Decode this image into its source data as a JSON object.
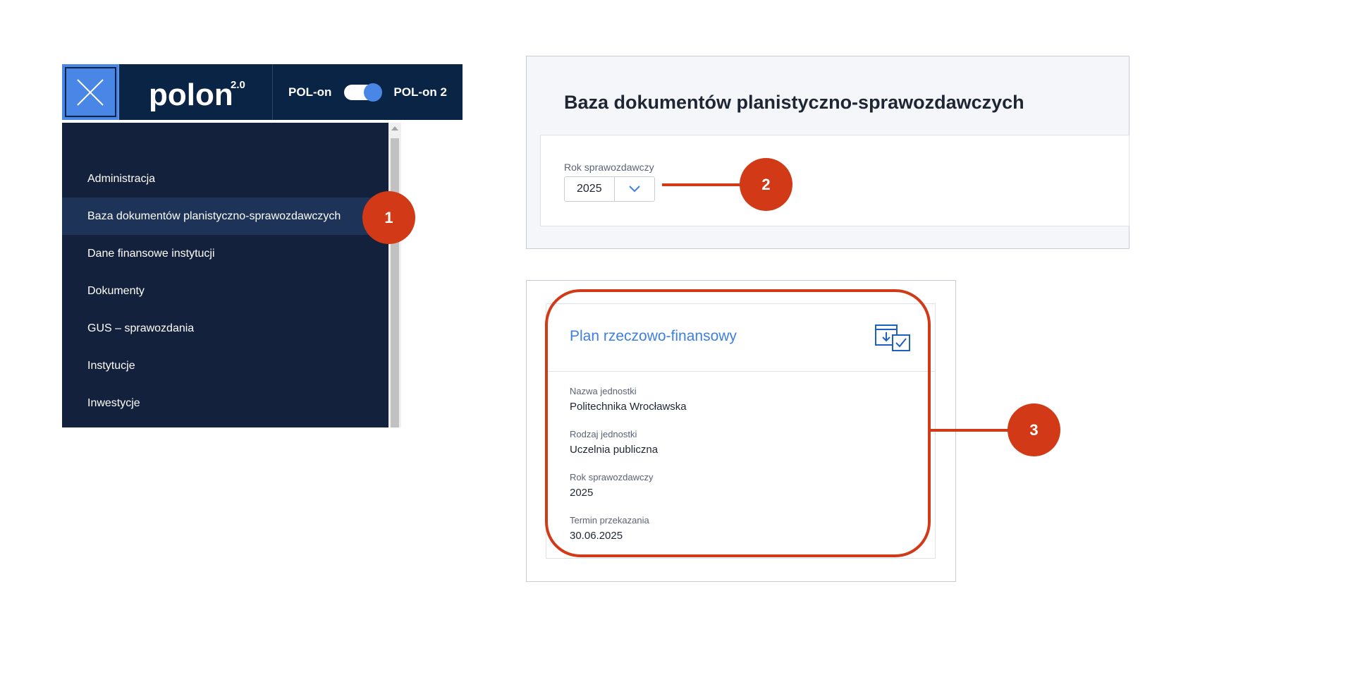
{
  "topbar": {
    "logo_text": "polon",
    "logo_version": "2.0",
    "toggle_left": "POL-on",
    "toggle_right": "POL-on 2",
    "toggle_state": "right"
  },
  "sidebar": {
    "items": [
      {
        "label": "Administracja",
        "active": false
      },
      {
        "label": "Baza dokumentów planistyczno-sprawozdawczych",
        "active": true
      },
      {
        "label": "Dane finansowe instytucji",
        "active": false
      },
      {
        "label": "Dokumenty",
        "active": false
      },
      {
        "label": "GUS – sprawozdania",
        "active": false
      },
      {
        "label": "Instytucje",
        "active": false
      },
      {
        "label": "Inwestycje",
        "active": false
      }
    ]
  },
  "callouts": [
    "1",
    "2",
    "3"
  ],
  "header": {
    "title": "Baza dokumentów planistyczno-sprawozdawczych"
  },
  "filter": {
    "label": "Rok sprawozdawczy",
    "value": "2025"
  },
  "card": {
    "title": "Plan rzeczowo-finansowy",
    "fields": [
      {
        "label": "Nazwa jednostki",
        "value": "Politechnika Wrocławska"
      },
      {
        "label": "Rodzaj jednostki",
        "value": "Uczelnia publiczna"
      },
      {
        "label": "Rok sprawozdawczy",
        "value": "2025"
      },
      {
        "label": "Termin przekazania",
        "value": "30.06.2025"
      }
    ]
  },
  "colors": {
    "navy": "#0a2446",
    "sidebar_bg": "#13213c",
    "accent_blue": "#4a86e6",
    "callout_red": "#d23a17"
  }
}
